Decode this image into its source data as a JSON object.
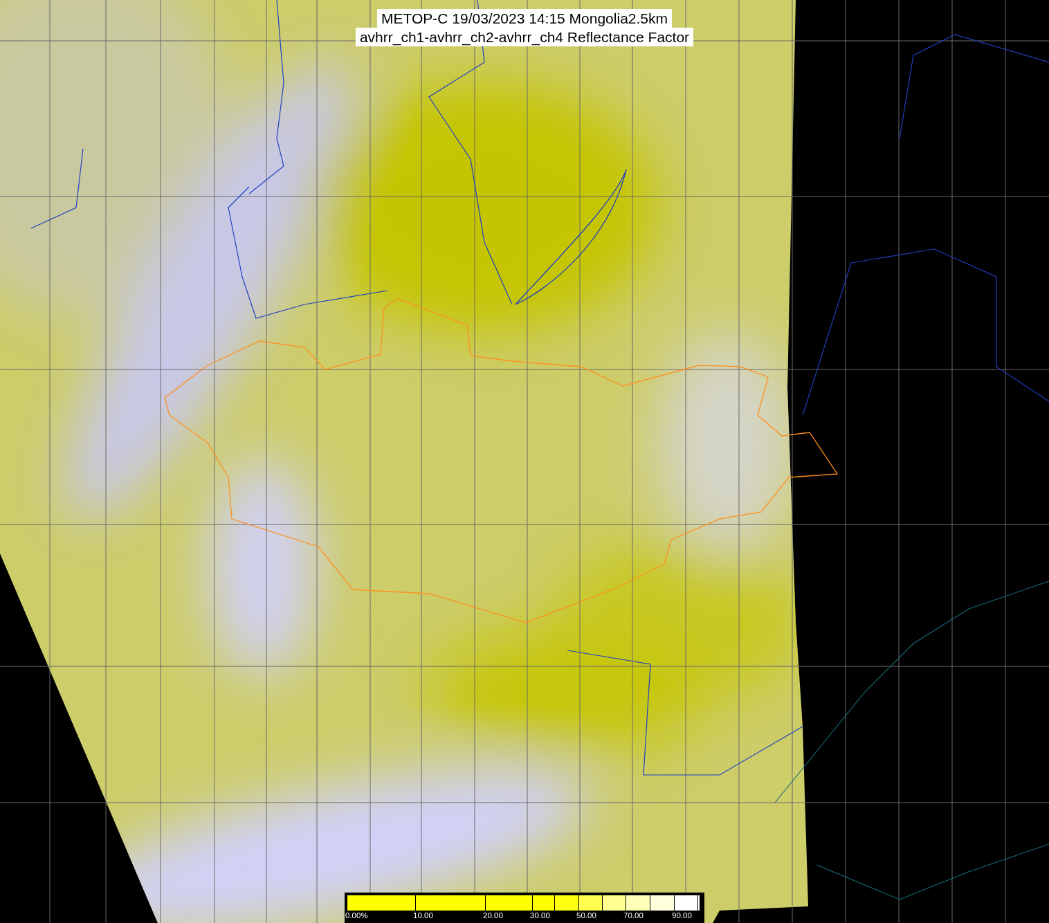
{
  "title_lines": [
    "METOP-C 19/03/2023 14:15 Mongolia2.5km",
    "avhrr_ch1-avhrr_ch2-avhrr_ch4 Reflectance Factor"
  ],
  "color_scale": {
    "segments": [
      {
        "color": "#ffff00",
        "label": "0.00%"
      },
      {
        "color": "#ffff00",
        "label": "10.00"
      },
      {
        "color": "#ffff00",
        "label": "20.00"
      },
      {
        "color": "#ffff00",
        "label": "30.00"
      },
      {
        "color": "#ffff10"
      },
      {
        "color": "#ffff50",
        "label": "50.00"
      },
      {
        "color": "#ffff90"
      },
      {
        "color": "#ffffb8",
        "label": "70.00"
      },
      {
        "color": "#ffffdc"
      },
      {
        "color": "#ffffff",
        "label": "90.00"
      },
      {
        "color": "#ffffff"
      }
    ]
  }
}
